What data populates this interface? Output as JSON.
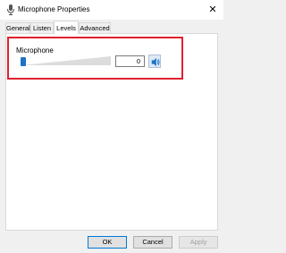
{
  "window": {
    "title": "Microphone Properties",
    "close_label": "✕"
  },
  "tabs": [
    {
      "label": "General",
      "active": false
    },
    {
      "label": "Listen",
      "active": false
    },
    {
      "label": "Levels",
      "active": true
    },
    {
      "label": "Advanced",
      "active": false
    }
  ],
  "levels": {
    "group_label": "Microphone",
    "slider_value_fraction": 0,
    "value": "0",
    "mute_icon": "speaker-icon"
  },
  "buttons": {
    "ok": "OK",
    "cancel": "Cancel",
    "apply": "Apply"
  },
  "colors": {
    "highlight": "#e0202e",
    "accent": "#1e73c8"
  }
}
